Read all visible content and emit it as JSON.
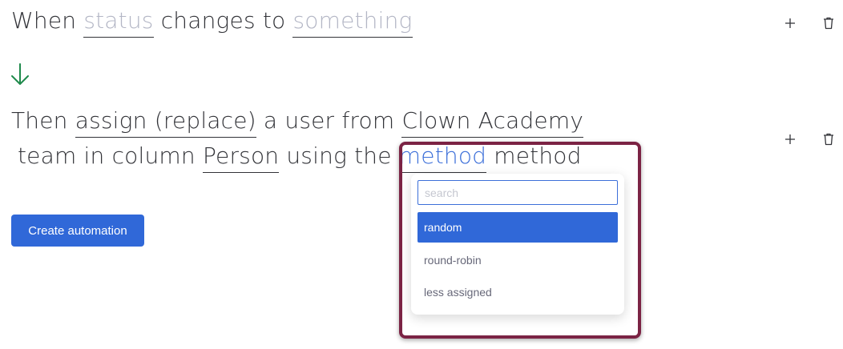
{
  "trigger": {
    "when": "When",
    "field": "status",
    "changes_to": "changes to",
    "value": "something"
  },
  "action": {
    "then": "Then",
    "verb": "assign (replace)",
    "a_user_from": "a user from",
    "team_name": "Clown Academy",
    "team_in_column": "team in column",
    "column": "Person",
    "using_the": "using the",
    "method": "method",
    "method_suffix": "method"
  },
  "row_actions": {
    "add_icon": "plus-icon",
    "delete_icon": "trash-icon"
  },
  "create_button": "Create automation",
  "dropdown": {
    "placeholder": "search",
    "search_value": "",
    "options": [
      "random",
      "round-robin",
      "less assigned"
    ],
    "selected": "random"
  },
  "colors": {
    "accent": "#3068d8",
    "arrow": "#1f8a4c",
    "highlight_border": "#7b2344",
    "placeholder_token": "#b3b6c5",
    "text": "#323338"
  }
}
